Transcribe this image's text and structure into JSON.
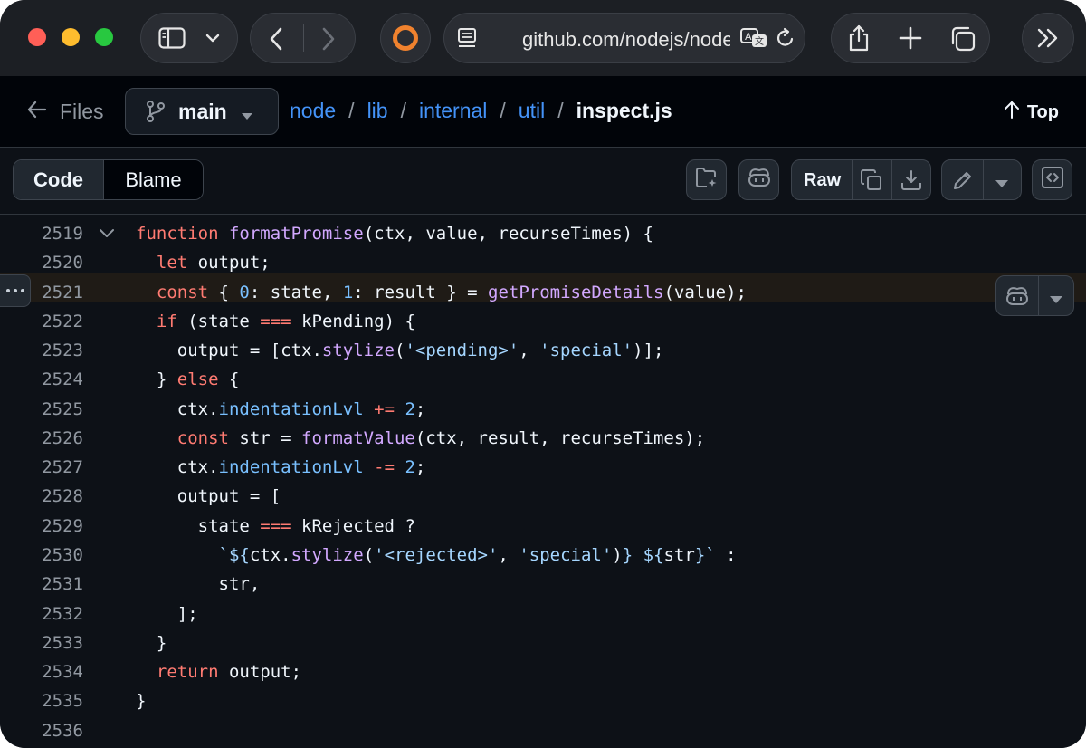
{
  "browser": {
    "url": "github.com/nodejs/node",
    "icons": [
      "sidebar-icon",
      "chevron-down-icon",
      "back-icon",
      "forward-icon",
      "extension-icon",
      "reader-icon",
      "translate-icon",
      "reload-icon",
      "share-icon",
      "new-tab-icon",
      "tabs-overview-icon",
      "more-icon"
    ]
  },
  "file_header": {
    "files_label": "Files",
    "branch": "main",
    "breadcrumb": [
      {
        "label": "node"
      },
      {
        "label": "lib"
      },
      {
        "label": "internal"
      },
      {
        "label": "util"
      }
    ],
    "separator": "/",
    "file_name": "inspect.js",
    "top_label": "Top"
  },
  "tabs": {
    "code": "Code",
    "blame": "Blame",
    "selected": "Code"
  },
  "actions": {
    "raw": "Raw",
    "icons": [
      "add-file-icon",
      "copilot-icon",
      "copy-icon",
      "download-icon",
      "edit-icon",
      "chevron-down-icon",
      "symbols-icon"
    ]
  },
  "code": {
    "highlighted_line": 2521,
    "lines": [
      {
        "n": "2519",
        "html": "<span class=\"k\">function</span> <span class=\"f\">formatPromise</span>(ctx, value, recurseTimes) {"
      },
      {
        "n": "2520",
        "html": "  <span class=\"k\">let</span> output;"
      },
      {
        "n": "2521",
        "html": "  <span class=\"k\">const</span> { <span class=\"p\">0</span>: state, <span class=\"p\">1</span>: result } = <span class=\"f\">getPromiseDetails</span>(value);"
      },
      {
        "n": "2522",
        "html": "  <span class=\"k\">if</span> (state <span class=\"k\">===</span> kPending) {"
      },
      {
        "n": "2523",
        "html": "    output = [ctx.<span class=\"f\">stylize</span>(<span class=\"s\">'&lt;pending&gt;'</span>, <span class=\"s\">'special'</span>)];"
      },
      {
        "n": "2524",
        "html": "  } <span class=\"k\">else</span> {"
      },
      {
        "n": "2525",
        "html": "    ctx.<span class=\"p\">indentationLvl</span> <span class=\"k\">+=</span> <span class=\"p\">2</span>;"
      },
      {
        "n": "2526",
        "html": "    <span class=\"k\">const</span> str = <span class=\"f\">formatValue</span>(ctx, result, recurseTimes);"
      },
      {
        "n": "2527",
        "html": "    ctx.<span class=\"p\">indentationLvl</span> <span class=\"k\">-=</span> <span class=\"p\">2</span>;"
      },
      {
        "n": "2528",
        "html": "    output = ["
      },
      {
        "n": "2529",
        "html": "      state <span class=\"k\">===</span> kRejected ?"
      },
      {
        "n": "2530",
        "html": "        <span class=\"s\">`${</span>ctx.<span class=\"f\">stylize</span>(<span class=\"s\">'&lt;rejected&gt;'</span>, <span class=\"s\">'special'</span>)<span class=\"s\">} ${</span>str<span class=\"s\">}`</span> :"
      },
      {
        "n": "2531",
        "html": "        str,"
      },
      {
        "n": "2532",
        "html": "    ];"
      },
      {
        "n": "2533",
        "html": "  }"
      },
      {
        "n": "2534",
        "html": "  <span class=\"k\">return</span> output;"
      },
      {
        "n": "2535",
        "html": "}"
      },
      {
        "n": "2536",
        "html": ""
      }
    ]
  },
  "colors": {
    "keyword": "#ff7b72",
    "function": "#d2a8ff",
    "constant": "#79c0ff",
    "string": "#a5d6ff",
    "link": "#4493f8"
  }
}
